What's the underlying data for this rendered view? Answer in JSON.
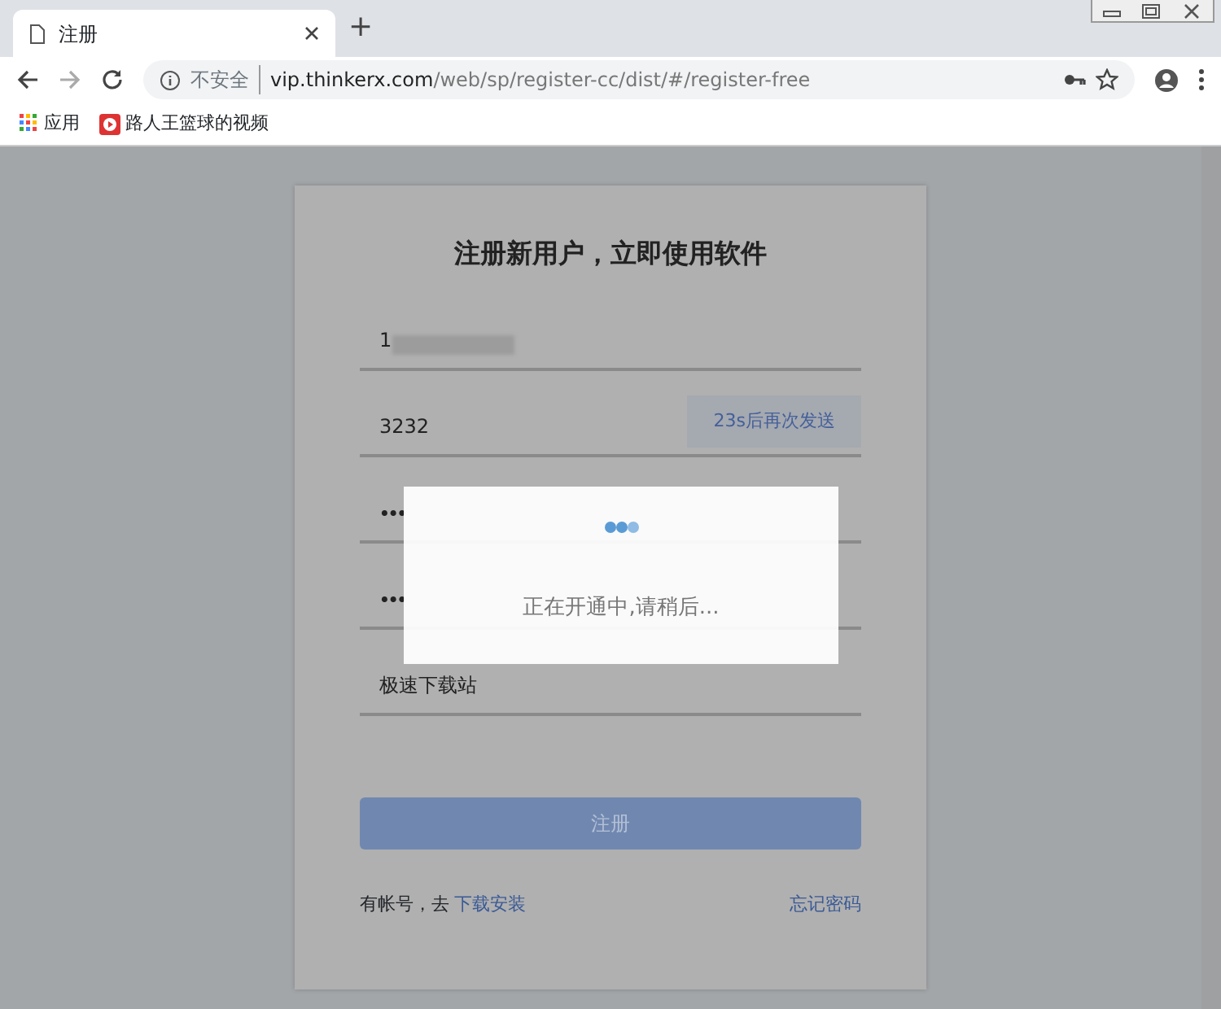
{
  "browser": {
    "tab_title": "注册",
    "new_tab": "+",
    "security": "不安全",
    "url_host": "vip.thinkerx.com",
    "url_path": "/web/sp/register-cc/dist/#/register-free",
    "bookmarks": [
      {
        "label": "应用",
        "kind": "apps"
      },
      {
        "label": "路人王篮球的视频",
        "kind": "video"
      }
    ]
  },
  "form": {
    "title": "注册新用户，立即使用软件",
    "fields": [
      {
        "kind": "text",
        "value": "1",
        "redacted": true
      },
      {
        "kind": "code",
        "value": "3232",
        "button": "23s后再次发送"
      },
      {
        "kind": "password",
        "value": "•••"
      },
      {
        "kind": "password",
        "value": "•••"
      },
      {
        "kind": "text",
        "value": "极速下载站",
        "redacted": false
      }
    ],
    "submit": "注册",
    "footer_text": "有帐号，去",
    "footer_link": "下载安装",
    "forgot": "忘记密码"
  },
  "dialog": {
    "message": "正在开通中,请稍后..."
  }
}
